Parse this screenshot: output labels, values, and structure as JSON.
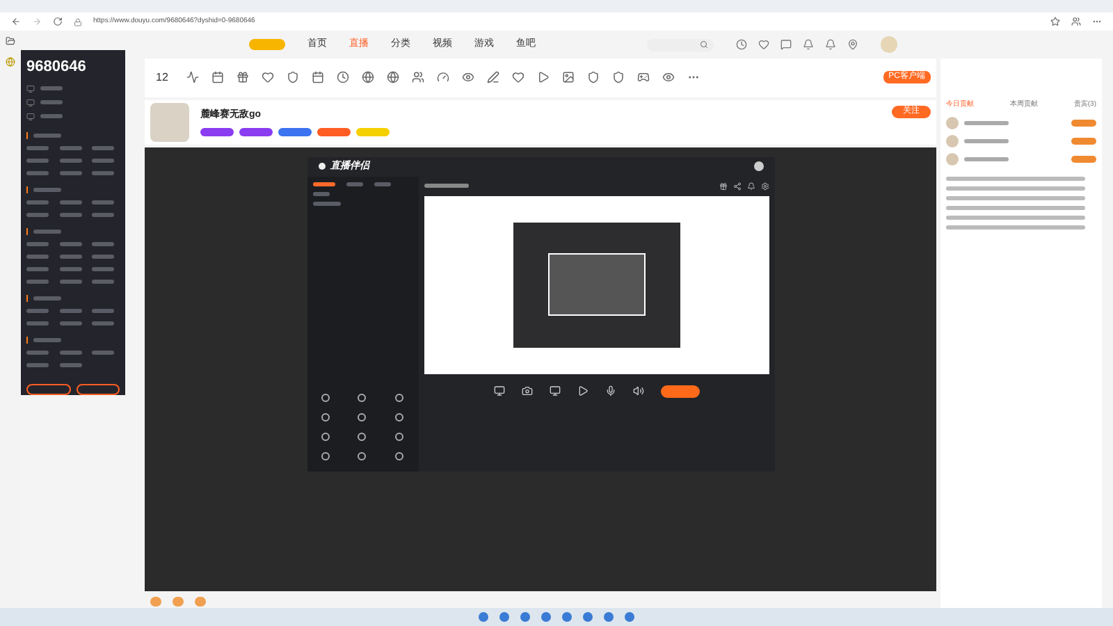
{
  "browser": {
    "url": "https://www.douyu.com/9680646?dyshid=0-9680646"
  },
  "header": {
    "nav": [
      {
        "label": "首页",
        "selected": false
      },
      {
        "label": "直播",
        "selected": true
      },
      {
        "label": "分类",
        "selected": false
      },
      {
        "label": "视频",
        "selected": false
      },
      {
        "label": "游戏",
        "selected": false
      },
      {
        "label": "鱼吧",
        "selected": false
      }
    ]
  },
  "sidebar": {
    "room_id": "9680646"
  },
  "toolbar": {
    "count": "12",
    "client_button": "PC客户端"
  },
  "streamer": {
    "name": "麓峰赛无敌go",
    "follow": "关注"
  },
  "capture_app": {
    "title": "直播伴侣"
  },
  "contributions": {
    "tabs": [
      {
        "label": "今日贡献",
        "selected": true
      },
      {
        "label": "本周贡献",
        "selected": false
      },
      {
        "label": "贵宾(3)",
        "selected": false
      }
    ]
  }
}
